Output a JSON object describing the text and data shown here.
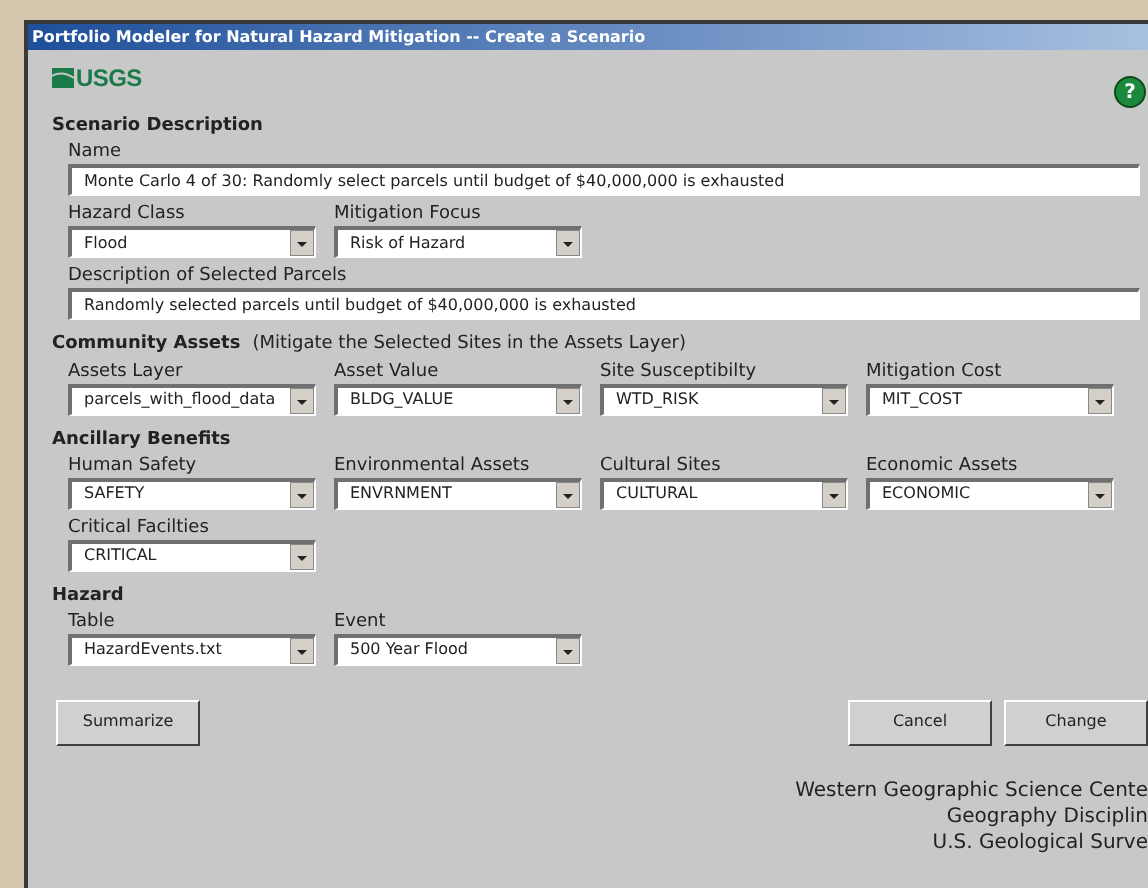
{
  "window": {
    "title": "Portfolio Modeler for Natural Hazard Mitigation -- Create a Scenario"
  },
  "logo": {
    "text": "USGS"
  },
  "help": {
    "label": "?"
  },
  "sections": [
    {
      "heading": "Scenario Description",
      "rows": [
        [
          {
            "kind": "text",
            "label": "Name",
            "value": "Monte Carlo 4 of 30: Randomly select parcels until budget of $40,000,000 is exhausted"
          }
        ],
        [
          {
            "kind": "select",
            "label": "Hazard Class",
            "value": "Flood"
          },
          {
            "kind": "select",
            "label": "Mitigation Focus",
            "value": "Risk of Hazard"
          }
        ],
        [
          {
            "kind": "text",
            "label": "Description of Selected Parcels",
            "value": "Randomly selected parcels until budget of $40,000,000 is exhausted"
          }
        ]
      ]
    },
    {
      "heading": "Community Assets",
      "note": "(Mitigate the Selected Sites in the Assets Layer)",
      "rows": [
        [
          {
            "kind": "select",
            "label": "Assets Layer",
            "value": "parcels_with_flood_data"
          },
          {
            "kind": "select",
            "label": "Asset Value",
            "value": "BLDG_VALUE"
          },
          {
            "kind": "select",
            "label": "Site Susceptibilty",
            "value": "WTD_RISK"
          },
          {
            "kind": "select",
            "label": "Mitigation Cost",
            "value": "MIT_COST"
          }
        ]
      ]
    },
    {
      "heading": "Ancillary Benefits",
      "rows": [
        [
          {
            "kind": "select",
            "label": "Human Safety",
            "value": "SAFETY"
          },
          {
            "kind": "select",
            "label": "Environmental Assets",
            "value": "ENVRNMENT"
          },
          {
            "kind": "select",
            "label": "Cultural Sites",
            "value": "CULTURAL"
          },
          {
            "kind": "select",
            "label": "Economic Assets",
            "value": "ECONOMIC"
          }
        ],
        [
          {
            "kind": "select",
            "label": "Critical Facilties",
            "value": "CRITICAL"
          }
        ]
      ]
    },
    {
      "heading": "Hazard",
      "rows": [
        [
          {
            "kind": "select",
            "label": "Table",
            "value": "HazardEvents.txt"
          },
          {
            "kind": "select",
            "label": "Event",
            "value": "500 Year Flood"
          }
        ]
      ]
    }
  ],
  "buttons": {
    "left": [
      "Summarize"
    ],
    "right": [
      "Cancel",
      "Change"
    ]
  },
  "footer": [
    "Western Geographic Science Cente",
    "Geography Disciplin",
    "U.S. Geological Surve"
  ]
}
